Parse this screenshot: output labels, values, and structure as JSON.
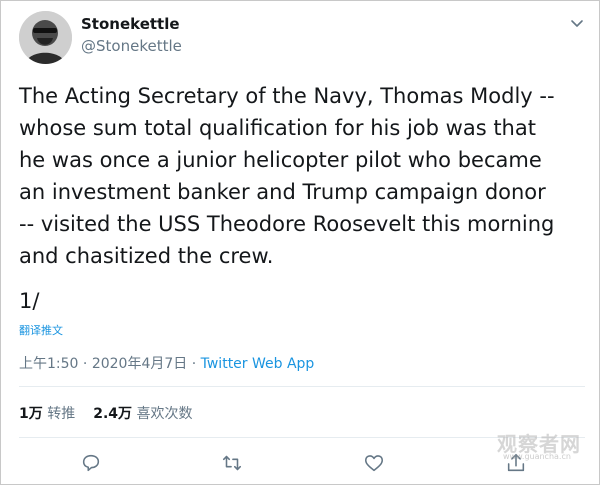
{
  "user": {
    "display_name": "Stonekettle",
    "handle": "@Stonekettle"
  },
  "tweet": {
    "text": "The Acting Secretary of the Navy, Thomas Modly --\nwhose sum total qualification for his job was that\nhe was once a junior helicopter pilot who became\nan investment banker and Trump campaign donor\n-- visited the USS Theodore Roosevelt this morning\nand chasitized the crew.",
    "thread_marker": "1/",
    "translate_label": "翻译推文",
    "time": "上午1:50",
    "separator": " · ",
    "date": "2020年4月7日",
    "source": "Twitter Web App"
  },
  "stats": {
    "retweets_count": "1万",
    "retweets_label": "转推",
    "likes_count": "2.4万",
    "likes_label": "喜欢次数"
  },
  "watermark": {
    "main": "观察者网",
    "sub": "www.guancha.cn"
  },
  "colors": {
    "accent": "#1b95e0",
    "secondary_text": "#657786",
    "primary_text": "#14171a",
    "divider": "#e6ecf0"
  },
  "icons": {
    "caret": "chevron-down-icon",
    "reply": "reply-icon",
    "retweet": "retweet-icon",
    "like": "heart-icon",
    "share": "share-icon"
  }
}
